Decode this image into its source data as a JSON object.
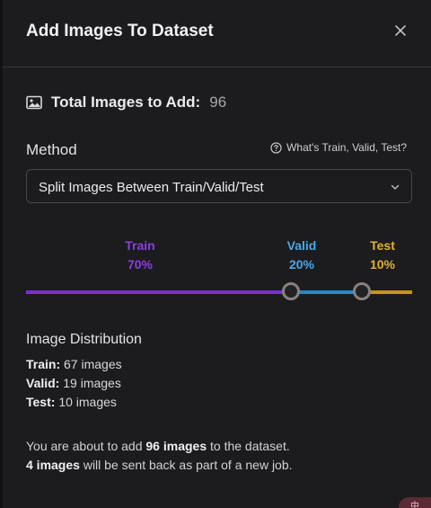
{
  "dialog": {
    "title": "Add Images To Dataset",
    "close_icon": "close-icon"
  },
  "total": {
    "icon": "image-icon",
    "label": "Total Images to Add:",
    "value": "96"
  },
  "method": {
    "label": "Method",
    "help_icon": "question-circle-icon",
    "help_text": "What's Train, Valid, Test?",
    "selected": "Split Images Between Train/Valid/Test",
    "chevron_icon": "chevron-down-icon"
  },
  "split": {
    "train": {
      "name": "Train",
      "percent": "70%",
      "color": "#7b2fd0",
      "value": 70
    },
    "valid": {
      "name": "Valid",
      "percent": "20%",
      "color": "#2d86c0",
      "value": 20
    },
    "test": {
      "name": "Test",
      "percent": "10%",
      "color": "#c4951e",
      "value": 10
    }
  },
  "distribution": {
    "title": "Image Distribution",
    "train_label": "Train:",
    "train_value": "67 images",
    "valid_label": "Valid:",
    "valid_value": "19 images",
    "test_label": "Test:",
    "test_value": "10 images"
  },
  "notice": {
    "line1_prefix": "You are about to add",
    "line1_bold": "96 images",
    "line1_suffix": "to the dataset.",
    "line2_bold": "4 images",
    "line2_suffix": "will be sent back as part of a new job."
  },
  "corner_badge": "中"
}
